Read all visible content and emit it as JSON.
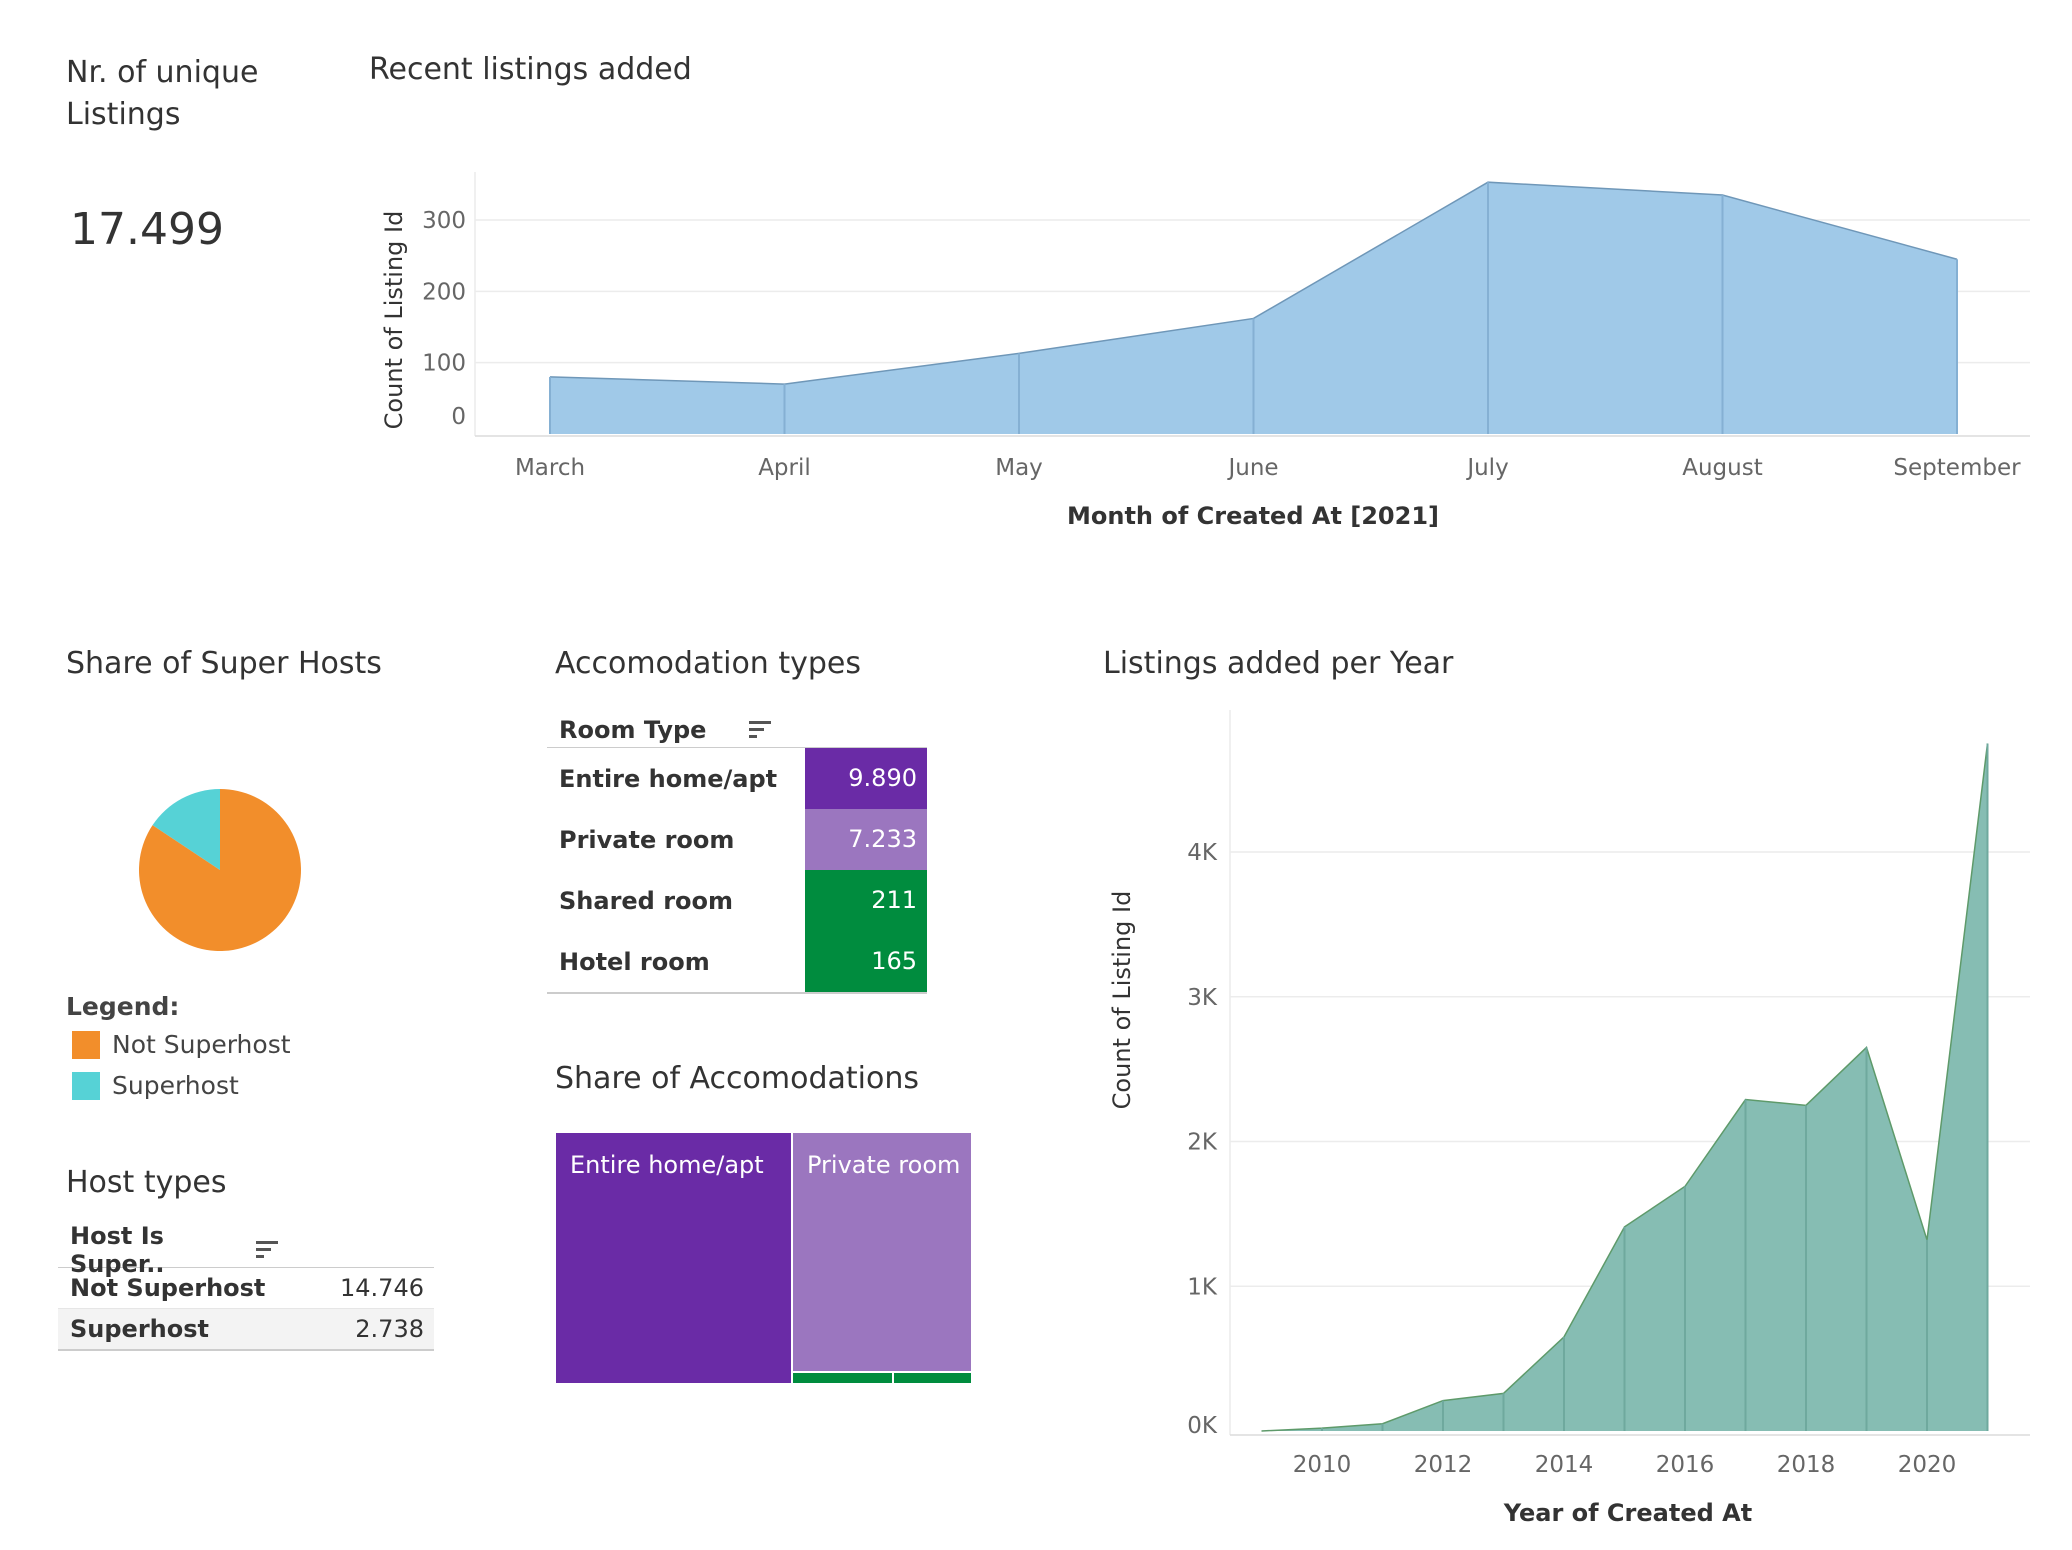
{
  "kpi": {
    "label": "Nr. of unique Listings",
    "value": "17.499"
  },
  "recent_chart": {
    "title": "Recent listings added",
    "xlabel": "Month of Created At [2021]",
    "ylabel": "Count of Listing Id",
    "y_ticks": [
      "0",
      "100",
      "200",
      "300"
    ]
  },
  "super_hosts": {
    "title": "Share of Super Hosts",
    "legend_title": "Legend:",
    "legend": [
      {
        "label": "Not Superhost",
        "color": "#f28e2b"
      },
      {
        "label": "Superhost",
        "color": "#56d2d6"
      }
    ]
  },
  "accom_types": {
    "title": "Accomodation types",
    "header": "Room Type",
    "rows": [
      {
        "label": "Entire home/apt",
        "value": "9.890",
        "color": "#6a2ba6"
      },
      {
        "label": "Private room",
        "value": "7.233",
        "color": "#9b76bf"
      },
      {
        "label": "Shared room",
        "value": "211",
        "color": "#008c3e"
      },
      {
        "label": "Hotel room",
        "value": "165",
        "color": "#008c3e"
      }
    ]
  },
  "share_accom": {
    "title": "Share of Accomodations",
    "labels": [
      "Entire home/apt",
      "Private room"
    ]
  },
  "host_types": {
    "title": "Host types",
    "header": "Host Is Super..",
    "rows": [
      {
        "label": "Not Superhost",
        "value": "14.746"
      },
      {
        "label": "Superhost",
        "value": "2.738"
      }
    ]
  },
  "yearly_chart": {
    "title": "Listings added per Year",
    "xlabel": "Year of Created At",
    "ylabel": "Count of Listing Id",
    "y_ticks": [
      "0K",
      "1K",
      "2K",
      "3K",
      "4K"
    ],
    "x_ticks": [
      "2010",
      "2012",
      "2014",
      "2016",
      "2018",
      "2020"
    ]
  },
  "chart_data": [
    {
      "type": "area",
      "title": "Recent listings added",
      "xlabel": "Month of Created At [2021]",
      "ylabel": "Count of Listing Id",
      "categories": [
        "March",
        "April",
        "May",
        "June",
        "July",
        "August",
        "September"
      ],
      "values": [
        80,
        70,
        113,
        162,
        353,
        335,
        245
      ],
      "ylim": [
        0,
        360
      ],
      "color": "#a0c9e8",
      "grid": true
    },
    {
      "type": "pie",
      "title": "Share of Super Hosts",
      "labels": [
        "Not Superhost",
        "Superhost"
      ],
      "values": [
        14746,
        2738
      ],
      "colors": [
        "#f28e2b",
        "#56d2d6"
      ],
      "legend": "bottom-left"
    },
    {
      "type": "table",
      "title": "Accomodation types",
      "categories": [
        "Entire home/apt",
        "Private room",
        "Shared room",
        "Hotel room"
      ],
      "values": [
        9890,
        7233,
        211,
        165
      ]
    },
    {
      "type": "heatmap",
      "title": "Share of Accomodations",
      "categories": [
        "Entire home/apt",
        "Private room",
        "Shared room",
        "Hotel room"
      ],
      "values": [
        9890,
        7233,
        211,
        165
      ],
      "colors": [
        "#6a2ba6",
        "#9b76bf",
        "#008c3e",
        "#008c3e"
      ]
    },
    {
      "type": "table",
      "title": "Host types",
      "categories": [
        "Not Superhost",
        "Superhost"
      ],
      "values": [
        14746,
        2738
      ]
    },
    {
      "type": "area",
      "title": "Listings added per Year",
      "xlabel": "Year of Created At",
      "ylabel": "Count of Listing Id",
      "x": [
        2009,
        2010,
        2011,
        2012,
        2013,
        2014,
        2015,
        2016,
        2017,
        2018,
        2019,
        2020,
        2021
      ],
      "values": [
        0,
        20,
        50,
        210,
        260,
        650,
        1410,
        1690,
        2290,
        2250,
        2650,
        1320,
        4750
      ],
      "ylim": [
        0,
        4800
      ],
      "color": "#86bdb3",
      "grid": true
    }
  ]
}
